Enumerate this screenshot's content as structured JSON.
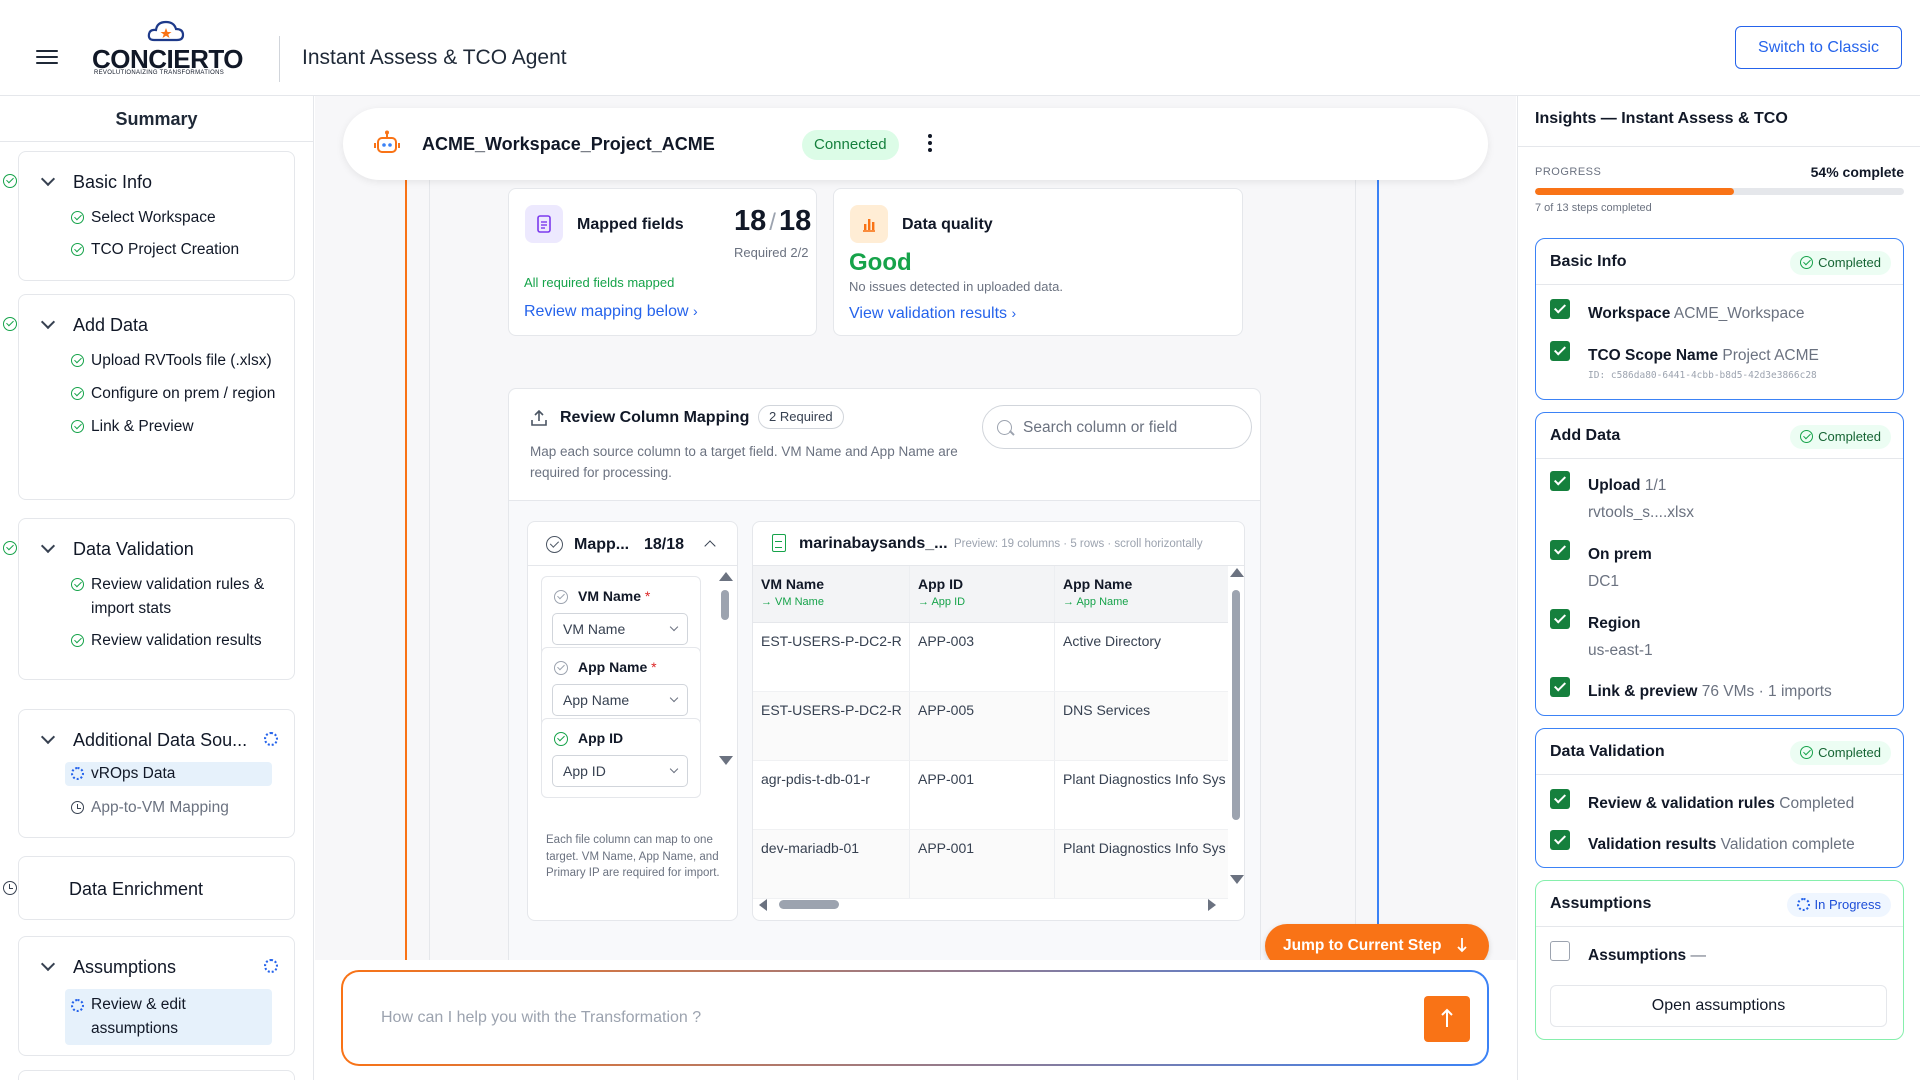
{
  "header": {
    "logo_text": "CONCIERTO",
    "logo_tagline": "REVOLUTIONAIZING TRANSFORMATIONS",
    "app_title": "Instant Assess & TCO Agent",
    "switch_label": "Switch to Classic"
  },
  "sidebar": {
    "title": "Summary",
    "sections": [
      {
        "title": "Basic Info",
        "status": "completed",
        "items": [
          "Select Workspace",
          "TCO Project Creation"
        ]
      },
      {
        "title": "Add Data",
        "status": "completed",
        "items": [
          "Upload RVTools file (.xlsx)",
          "Configure on prem / region",
          "Link & Preview"
        ]
      },
      {
        "title": "Data Validation",
        "status": "completed",
        "items": [
          "Review validation rules & import stats",
          "Review validation results"
        ]
      },
      {
        "title": "Additional Data Sou...",
        "status": "in-progress",
        "items": [
          "vROps Data",
          "App-to-VM Mapping"
        ]
      },
      {
        "title": "Data Enrichment",
        "status": "pending",
        "items": []
      },
      {
        "title": "Assumptions",
        "status": "in-progress",
        "items": [
          "Review & edit assumptions"
        ]
      }
    ]
  },
  "project": {
    "name": "ACME_Workspace_Project_ACME",
    "status": "Connected"
  },
  "mapped_card": {
    "title": "Mapped fields",
    "mapped": "18",
    "total": "18",
    "required": "Required 2/2",
    "note": "All required fields mapped",
    "link": "Review mapping below"
  },
  "quality_card": {
    "title": "Data quality",
    "value": "Good",
    "note": "No issues detected in uploaded data.",
    "link": "View validation results"
  },
  "column_mapping": {
    "title": "Review Column Mapping",
    "badge": "2 Required",
    "description": "Map each source column to a target field. VM Name and App Name are required for processing.",
    "search_placeholder": "Search column or field",
    "panel": {
      "title": "Mapp...",
      "count": "18/18",
      "fields": [
        {
          "label": "VM Name",
          "required": true,
          "value": "VM Name",
          "state": "gray"
        },
        {
          "label": "App Name",
          "required": true,
          "value": "App Name",
          "state": "gray"
        },
        {
          "label": "App ID",
          "required": false,
          "value": "App ID",
          "state": "green"
        }
      ],
      "footnote": "Each file column can map to one target. VM Name, App Name, and Primary IP are required for import."
    },
    "preview": {
      "file": "marinabaysands_...",
      "meta": "Preview: 19 columns · 5 rows · scroll horizontally",
      "columns": [
        {
          "name": "VM Name",
          "mapped": "→ VM Name"
        },
        {
          "name": "App ID",
          "mapped": "→ App ID"
        },
        {
          "name": "App Name",
          "mapped": "→ App Name"
        }
      ],
      "rows": [
        [
          "EST-USERS-P-DC2-R",
          "APP-003",
          "Active Directory"
        ],
        [
          "EST-USERS-P-DC2-R",
          "APP-005",
          "DNS Services"
        ],
        [
          "agr-pdis-t-db-01-r",
          "APP-001",
          "Plant Diagnostics Info Sys"
        ],
        [
          "dev-mariadb-01",
          "APP-001",
          "Plant Diagnostics Info Sys"
        ]
      ]
    }
  },
  "jump_button": "Jump to Current Step",
  "chat": {
    "placeholder": "How can I help you with the Transformation ?"
  },
  "insights": {
    "title": "Insights — Instant Assess & TCO",
    "progress_label": "PROGRESS",
    "progress_text": "54% complete",
    "progress_value": 0.54,
    "steps_text": "7 of 13 steps completed",
    "sections": [
      {
        "title": "Basic Info",
        "badge": "Completed",
        "items": [
          {
            "label": "Workspace",
            "value": "ACME_Workspace",
            "checked": true
          },
          {
            "label": "TCO Scope Name",
            "value": "Project ACME",
            "id": "ID: c586da80-6441-4cbb-b8d5-42d3e3866c28",
            "checked": true
          }
        ]
      },
      {
        "title": "Add Data",
        "badge": "Completed",
        "items": [
          {
            "label": "Upload",
            "value": "1/1",
            "sub": "rvtools_s....xlsx",
            "checked": true
          },
          {
            "label": "On prem",
            "sub": "DC1",
            "checked": true
          },
          {
            "label": "Region",
            "sub": "us-east-1",
            "checked": true
          },
          {
            "label": "Link & preview",
            "value": "76 VMs · 1 imports",
            "checked": true
          }
        ]
      },
      {
        "title": "Data Validation",
        "badge": "Completed",
        "items": [
          {
            "label": "Review & validation rules",
            "value": "Completed",
            "checked": true
          },
          {
            "label": "Validation results",
            "value": "Validation complete",
            "checked": true
          }
        ]
      },
      {
        "title": "Assumptions",
        "badge": "In Progress",
        "items": [
          {
            "label": "Assumptions",
            "value": "—",
            "checked": false
          }
        ],
        "button": "Open assumptions"
      }
    ]
  },
  "colors": {
    "accent_orange": "#f97316",
    "accent_blue": "#2563eb",
    "success_green": "#16a34a"
  }
}
